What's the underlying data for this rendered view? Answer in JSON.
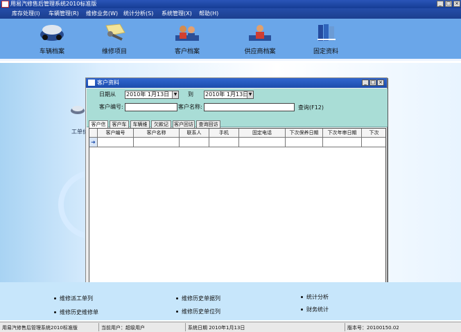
{
  "window": {
    "title": "用易汽修售后管理系统2010标准版"
  },
  "menu": [
    "库存处理(I)",
    "车辆管理(R)",
    "维修业务(W)",
    "统计分析(S)",
    "系统管理(X)",
    "帮助(H)"
  ],
  "toolbar": [
    {
      "label": "车辆档案",
      "icon": "car-file-icon"
    },
    {
      "label": "维修项目",
      "icon": "wrench-icon"
    },
    {
      "label": "客户档案",
      "icon": "customer-icon"
    },
    {
      "label": "供应商档案",
      "icon": "supplier-icon"
    },
    {
      "label": "固定资料",
      "icon": "books-icon"
    }
  ],
  "background": {
    "label": "工单价"
  },
  "child_window": {
    "title": "客户资料",
    "date_label": "日期从",
    "date_from": "2010年 1月13日",
    "date_to_label": "到",
    "date_to": "2010年 1月13日",
    "customer_code_label": "客户编号:",
    "customer_name_label": "客户名称:",
    "query_label": "查询(F12)",
    "tabs": [
      "客户信息",
      "客户车辆",
      "车辆维修",
      "欠款记录",
      "客户回访",
      "查询回访"
    ],
    "columns": [
      "客户编号",
      "客户名称",
      "联系人",
      "手机",
      "固定电话",
      "下次保养日期",
      "下次年审日期",
      "下次"
    ],
    "rows": []
  },
  "bottom_links": [
    {
      "label": "维修派工单列"
    },
    {
      "label": "维修历史维修单"
    },
    {
      "label": "统计分析"
    },
    {
      "label": "维修历史单据列"
    },
    {
      "label": "维修历史单位列"
    },
    {
      "label": "财务统计"
    }
  ],
  "status": {
    "app": "用易汽修售后管理系统2010标准版",
    "user": "当前用户：超级用户",
    "date": "系统日期 2010年1月13日",
    "version": "版本号：20100150.02"
  }
}
